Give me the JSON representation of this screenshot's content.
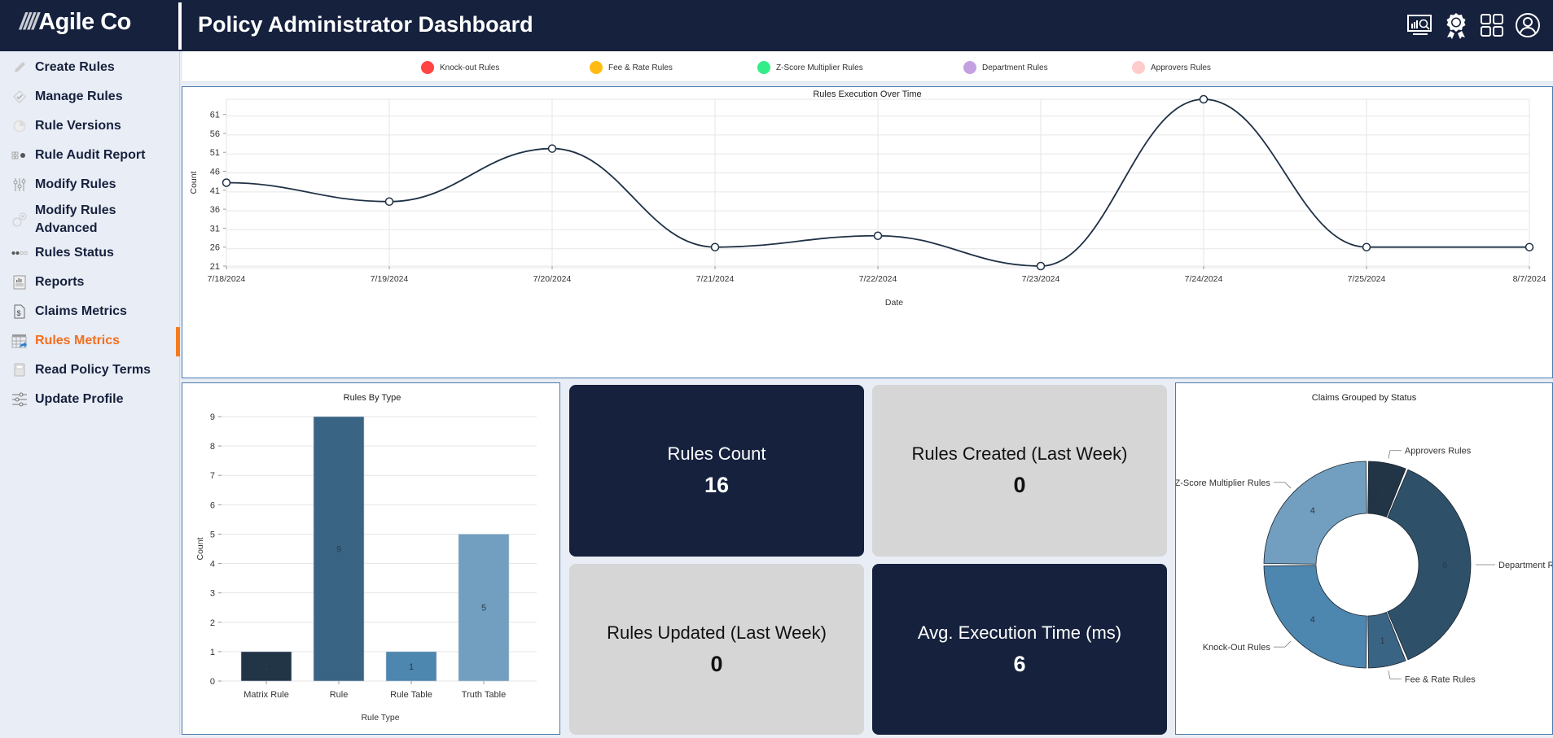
{
  "header": {
    "logo_slashes": "////",
    "logo_text": "Agile Co",
    "title": "Policy Administrator Dashboard",
    "icons": [
      "analytics-monitor-icon",
      "award-badge-icon",
      "apps-grid-icon",
      "user-profile-icon"
    ]
  },
  "sidebar": {
    "items": [
      {
        "label": "Create Rules",
        "icon": "pencil-icon"
      },
      {
        "label": "Manage Rules",
        "icon": "check-diamond-icon"
      },
      {
        "label": "Rule Versions",
        "icon": "history-circle-icon"
      },
      {
        "label": "Rule Audit Report",
        "icon": "audit-icon"
      },
      {
        "label": "Modify Rules",
        "icon": "sliders-icon"
      },
      {
        "label": "Modify Rules Advanced",
        "icon": "gears-icon"
      },
      {
        "label": "Rules Status",
        "icon": "status-dots-icon"
      },
      {
        "label": "Reports",
        "icon": "report-doc-icon"
      },
      {
        "label": "Claims Metrics",
        "icon": "dollar-doc-icon"
      },
      {
        "label": "Rules Metrics",
        "icon": "table-share-icon",
        "active": true
      },
      {
        "label": "Read Policy Terms",
        "icon": "book-icon"
      },
      {
        "label": "Update Profile",
        "icon": "settings-sliders-icon"
      }
    ],
    "active_color": "#f26f21"
  },
  "legend": [
    {
      "label": "Knock-out Rules",
      "color": "#ff4444"
    },
    {
      "label": "Fee & Rate Rules",
      "color": "#ffbb11"
    },
    {
      "label": "Z-Score Multiplier Rules",
      "color": "#33ee88"
    },
    {
      "label": "Department Rules",
      "color": "#c4a0e0"
    },
    {
      "label": "Approvers Rules",
      "color": "#ffcccc"
    }
  ],
  "kpis": [
    {
      "label": "Rules Count",
      "value": "16",
      "theme": "dark"
    },
    {
      "label": "Rules Created (Last Week)",
      "value": "0",
      "theme": "light"
    },
    {
      "label": "Rules Updated (Last Week)",
      "value": "0",
      "theme": "light"
    },
    {
      "label": "Avg. Execution Time (ms)",
      "value": "6",
      "theme": "dark"
    }
  ],
  "chart_data": [
    {
      "type": "line",
      "title": "Rules Execution Over Time",
      "xlabel": "Date",
      "ylabel": "Count",
      "categories": [
        "7/18/2024",
        "7/19/2024",
        "7/20/2024",
        "7/21/2024",
        "7/22/2024",
        "7/23/2024",
        "7/24/2024",
        "7/25/2024",
        "8/7/2024"
      ],
      "values": [
        43,
        38,
        52,
        26,
        29,
        21,
        65,
        26,
        26
      ],
      "yticks": [
        21,
        26,
        31,
        36,
        41,
        46,
        51,
        56,
        61
      ],
      "ylim": [
        21,
        65
      ],
      "grid": true,
      "line_color": "#1f3045"
    },
    {
      "type": "bar",
      "title": "Rules By Type",
      "xlabel": "Rule Type",
      "ylabel": "Count",
      "categories": [
        "Matrix Rule",
        "Rule",
        "Rule Table",
        "Truth Table"
      ],
      "values": [
        1,
        9,
        1,
        5
      ],
      "colors": [
        "#213547",
        "#3a6483",
        "#4d86ae",
        "#729fbf"
      ],
      "ylim": [
        0,
        9
      ],
      "yticks": [
        0,
        1,
        2,
        3,
        4,
        5,
        6,
        7,
        8,
        9
      ],
      "grid": true
    },
    {
      "type": "pie",
      "title": "Claims Grouped by Status",
      "donut": true,
      "slices": [
        {
          "label": "Approvers Rules",
          "value": 1,
          "color": "#213547"
        },
        {
          "label": "Department Rules",
          "value": 6,
          "color": "#2e5069"
        },
        {
          "label": "Fee & Rate Rules",
          "value": 1,
          "color": "#3a6483"
        },
        {
          "label": "Knock-Out Rules",
          "value": 4,
          "color": "#4d86ae"
        },
        {
          "label": "Z-Score Multiplier Rules",
          "value": 4,
          "color": "#729fbf"
        }
      ]
    }
  ]
}
